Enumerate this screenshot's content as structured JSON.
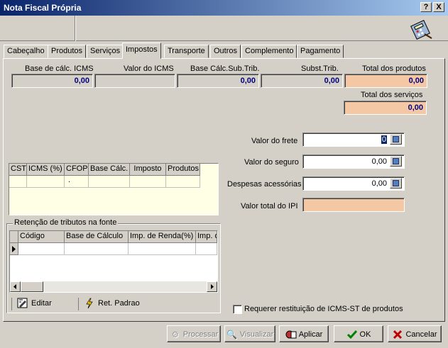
{
  "window": {
    "title": "Nota Fiscal Própria",
    "help_btn": "?",
    "close_btn": "X"
  },
  "tabs": [
    "Cabeçalho",
    "Produtos",
    "Serviços",
    "Impostos",
    "Transporte",
    "Outros",
    "Complemento",
    "Pagamento"
  ],
  "active_tab": "Impostos",
  "totals": {
    "base_icms_label": "Base de cálc. ICMS",
    "base_icms_value": "0,00",
    "valor_icms_label": "Valor do ICMS",
    "valor_icms_value": "",
    "base_sub_label": "Base Cálc.Sub.Trib.",
    "base_sub_value": "0,00",
    "subst_label": "Subst.Trib.",
    "subst_value": "0,00",
    "total_produtos_label": "Total dos produtos",
    "total_produtos_value": "0,00",
    "total_servicos_label": "Total dos serviços",
    "total_servicos_value": "0,00"
  },
  "fields": {
    "frete_label": "Valor do frete",
    "frete_value": "0",
    "seguro_label": "Valor do seguro",
    "seguro_value": "0,00",
    "despesas_label": "Despesas acessórias",
    "despesas_value": "0,00",
    "ipi_label": "Valor total do IPI",
    "ipi_value": ""
  },
  "icms_grid": {
    "columns": [
      "CST",
      "ICMS (%)",
      "CFOP",
      "Base Cálc.",
      "Imposto",
      "Produtos"
    ],
    "row": [
      "",
      "",
      "",
      ".",
      "",
      "",
      ""
    ]
  },
  "retencao": {
    "title": "Retenção de tributos na fonte",
    "columns": [
      "Código",
      "Base de Cálculo",
      "Imp. de Renda(%)",
      "Imp. d"
    ],
    "editar_label": "Editar",
    "ret_padrao_label": "Ret. Padrao"
  },
  "checkbox": {
    "label": "Requerer restituição de ICMS-ST de produtos",
    "checked": false
  },
  "buttons": {
    "processar": "Processar",
    "visualizar": "Visualizar",
    "aplicar": "Aplicar",
    "ok": "OK",
    "cancelar": "Cancelar"
  }
}
